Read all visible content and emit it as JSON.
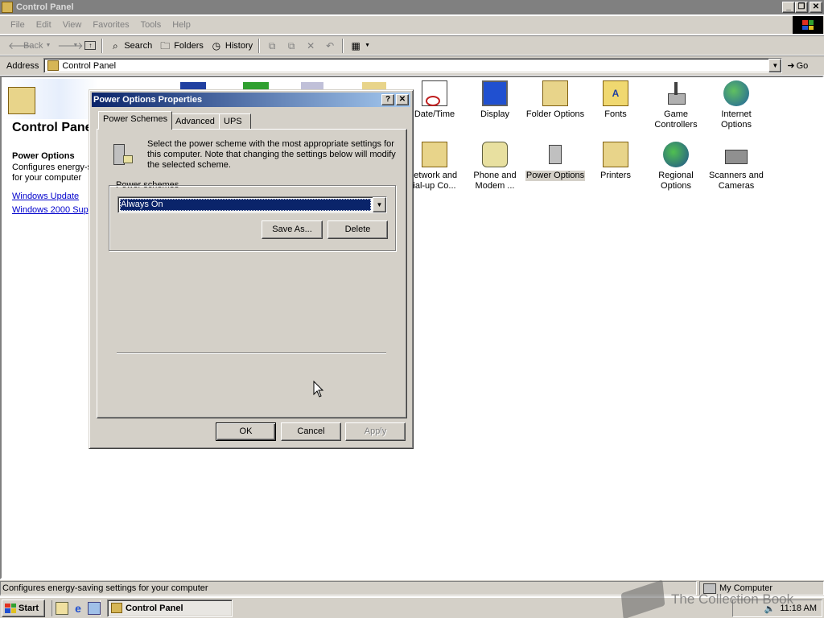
{
  "window": {
    "title": "Control Panel"
  },
  "menu": [
    "File",
    "Edit",
    "View",
    "Favorites",
    "Tools",
    "Help"
  ],
  "toolbar": {
    "back": "Back",
    "search": "Search",
    "folders": "Folders",
    "history": "History"
  },
  "address": {
    "label": "Address",
    "value": "Control Panel",
    "go": "Go"
  },
  "left_panel": {
    "title": "Control Panel",
    "selected_title": "Power Options",
    "selected_desc": "Configures energy-s\nfor your computer",
    "links": [
      "Windows Update",
      "Windows 2000 Supp"
    ]
  },
  "icons": {
    "datetime": "Date/Time",
    "display": "Display",
    "folder_options": "Folder Options",
    "fonts": "Fonts",
    "game_controllers": "Game Controllers",
    "internet_options": "Internet Options",
    "network": "letwork and ial-up Co...",
    "phone_modem": "Phone and Modem ...",
    "power_options": "Power Options",
    "printers": "Printers",
    "regional": "Regional Options",
    "scanners": "Scanners and Cameras"
  },
  "dialog": {
    "title": "Power Options Properties",
    "tabs": [
      "Power Schemes",
      "Advanced",
      "UPS"
    ],
    "intro": "Select the power scheme with the most appropriate settings for this computer. Note that changing the settings below will modify the selected scheme.",
    "group_label": "Power schemes",
    "scheme_value": "Always On",
    "save_as": "Save As...",
    "delete": "Delete",
    "ok": "OK",
    "cancel": "Cancel",
    "apply": "Apply"
  },
  "status": {
    "text": "Configures energy-saving settings for your computer",
    "zone": "My Computer"
  },
  "taskbar": {
    "start": "Start",
    "task": "Control Panel",
    "time": "11:18 AM"
  },
  "watermark": "The Collection Book",
  "colors": {
    "title_active": "#0a246a",
    "title_inactive": "#808080",
    "face": "#d4d0c8",
    "link": "#0000cc"
  }
}
